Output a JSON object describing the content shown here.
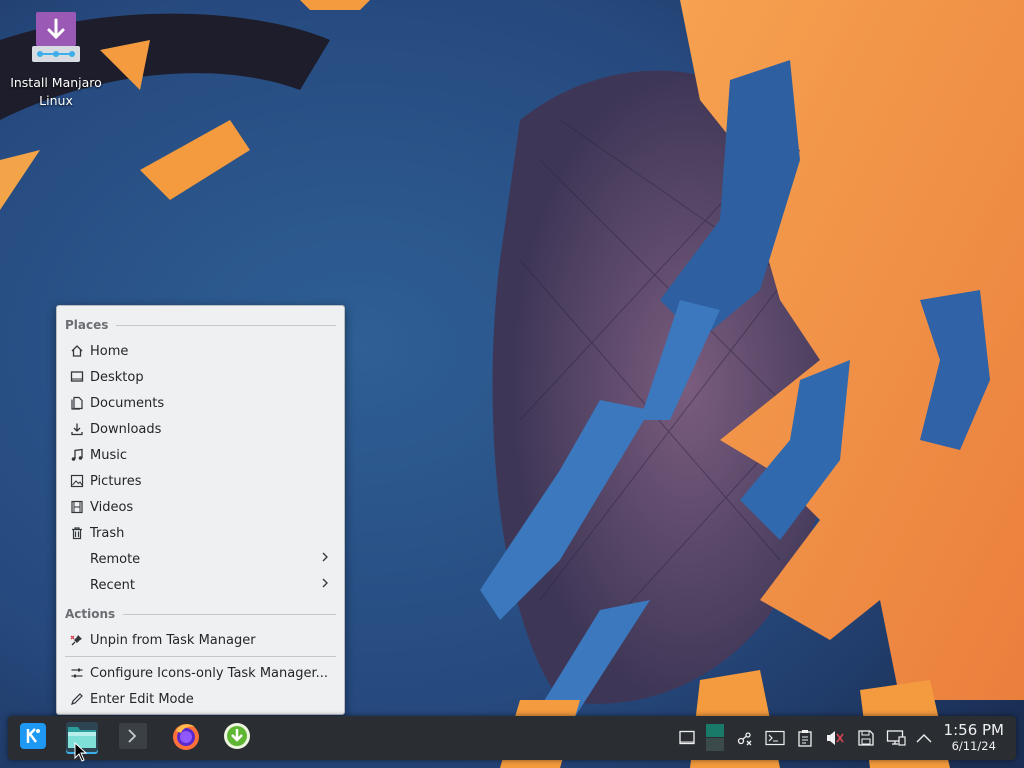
{
  "desktop": {
    "icons": [
      {
        "name": "install-manjaro-icon",
        "label_line1": "Install Manjaro",
        "label_line2": "Linux"
      }
    ]
  },
  "context_menu": {
    "places_header": "Places",
    "places": [
      {
        "label": "Home",
        "icon": "home-icon"
      },
      {
        "label": "Desktop",
        "icon": "desktop-icon"
      },
      {
        "label": "Documents",
        "icon": "documents-icon"
      },
      {
        "label": "Downloads",
        "icon": "downloads-icon"
      },
      {
        "label": "Music",
        "icon": "music-icon"
      },
      {
        "label": "Pictures",
        "icon": "pictures-icon"
      },
      {
        "label": "Videos",
        "icon": "videos-icon"
      },
      {
        "label": "Trash",
        "icon": "trash-icon"
      },
      {
        "label": "Remote",
        "icon": "chevron-right-icon"
      },
      {
        "label": "Recent",
        "icon": "chevron-right-icon"
      }
    ],
    "actions_header": "Actions",
    "actions": [
      {
        "label": "Unpin from Task Manager",
        "icon": "unpin-icon"
      },
      {
        "label": "Configure Icons-only Task Manager...",
        "icon": "configure-icon"
      },
      {
        "label": "Enter Edit Mode",
        "icon": "edit-icon"
      }
    ]
  },
  "taskbar": {
    "launchers": [
      "application-launcher-icon",
      "file-manager-icon",
      "terminal-icon",
      "firefox-icon",
      "installer-icon"
    ],
    "tray": [
      "show-desktop-icon",
      "pager-icon",
      "network-icon",
      "terminal-tray-icon",
      "clipboard-icon",
      "volume-muted-icon",
      "disks-icon",
      "display-icon",
      "expand-tray-icon"
    ],
    "clock": {
      "time": "1:56 PM",
      "date": "6/11/24"
    }
  },
  "colors": {
    "accent": "#3daee9",
    "panel": "#2a2e32",
    "menu_bg": "#eff0f1"
  }
}
